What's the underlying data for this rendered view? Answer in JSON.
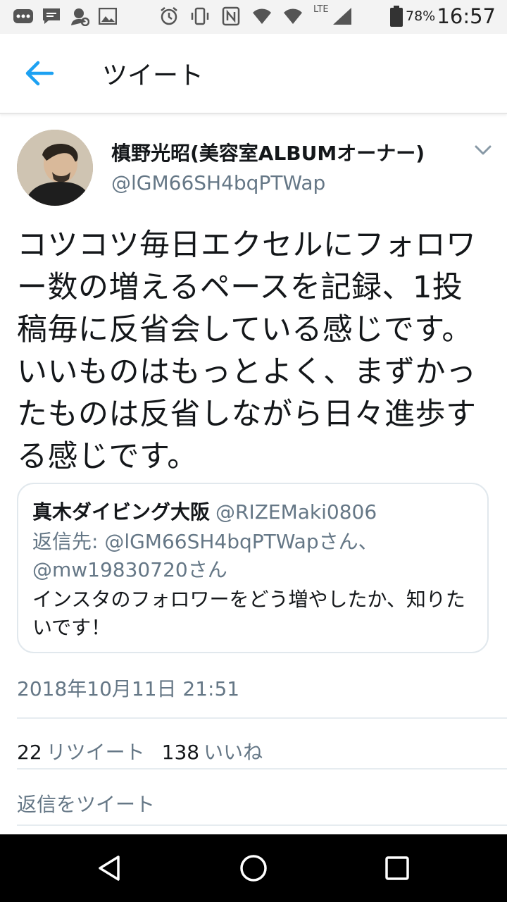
{
  "status_bar": {
    "battery_percent": "78%",
    "time": "16:57",
    "network": "LTE",
    "icons_left": [
      "more-icon",
      "message-icon",
      "contact-sync-icon",
      "image-icon"
    ],
    "icons_right": [
      "alarm-icon",
      "vibrate-icon",
      "nfc-icon",
      "wifi-signal-icon",
      "wifi-icon",
      "lte-signal-icon",
      "battery-icon"
    ]
  },
  "header": {
    "title": "ツイート",
    "back_icon": "arrow-left-icon"
  },
  "tweet": {
    "author_name": "槙野光昭(美容室ALBUMオーナー)",
    "author_handle": "@lGM66SH4bqPTWap",
    "text": "コツコツ毎日エクセルにフォロワー数の増えるペースを記録、1投稿毎に反省会している感じです。いいものはもっとよく、まずかったものは反省しながら日々進歩する感じです。",
    "menu_icon": "chevron-down-icon"
  },
  "quoted_tweet": {
    "author_name": "真木ダイビング大阪",
    "author_handle": "@RIZEMaki0806",
    "reply_to": "返信先: @lGM66SH4bqPTWapさん、@mw19830720さん",
    "text": "インスタのフォロワーをどう増やしたか、知りたいです！"
  },
  "timestamp": "2018年10月11日 21:51",
  "stats": {
    "retweets": "22",
    "retweets_label": "リツイート",
    "likes": "138",
    "likes_label": "いいね"
  },
  "reply_placeholder": "返信をツイート",
  "colors": {
    "accent": "#1da1f2",
    "text_primary": "#14171a",
    "text_secondary": "#657786"
  }
}
